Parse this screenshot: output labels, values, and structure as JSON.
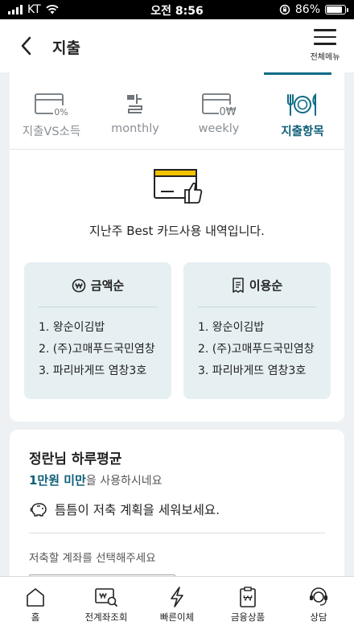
{
  "status": {
    "carrier": "KT",
    "time": "오전 8:56",
    "battery": "86%",
    "battery_level": 0.86
  },
  "header": {
    "title": "지출",
    "menu_label": "전체메뉴"
  },
  "tabs": [
    {
      "label": "지출VS소득",
      "icon": "card-percent-icon",
      "active": false
    },
    {
      "label": "monthly",
      "icon": "calendar-icon",
      "active": false
    },
    {
      "label": "weekly",
      "icon": "card-won-icon",
      "active": false
    },
    {
      "label": "지출항목",
      "icon": "utensils-icon",
      "active": true
    }
  ],
  "summary": "지난주 Best 카드사용 내역입니다.",
  "ranking": {
    "by_amount": {
      "title": "금액순",
      "items": [
        "1. 왕순이김밥",
        "2. (주)고매푸드국민염창",
        "3. 파리바게뜨 염창3호"
      ]
    },
    "by_usage": {
      "title": "이용순",
      "items": [
        "1. 왕순이김밥",
        "2. (주)고매푸드국민염창",
        "3. 파리바게뜨 염창3호"
      ]
    }
  },
  "daily_avg": {
    "title": "정란님 하루평균",
    "highlight": "1만원 미만",
    "suffix": "을 사용하시네요",
    "tip": "틈틈이 저축 계획을 세워보세요.",
    "account_label": "저축할 계좌를 선택해주세요"
  },
  "bottom_nav": [
    {
      "label": "홈",
      "icon": "home-icon"
    },
    {
      "label": "전계좌조회",
      "icon": "account-search-icon"
    },
    {
      "label": "빠른이체",
      "icon": "lightning-icon"
    },
    {
      "label": "금융상품",
      "icon": "product-icon"
    },
    {
      "label": "상담",
      "icon": "headset-icon"
    }
  ],
  "colors": {
    "accent": "#0e5f78",
    "panel": "#e6f0f3",
    "card_icon": "#f2c200"
  }
}
